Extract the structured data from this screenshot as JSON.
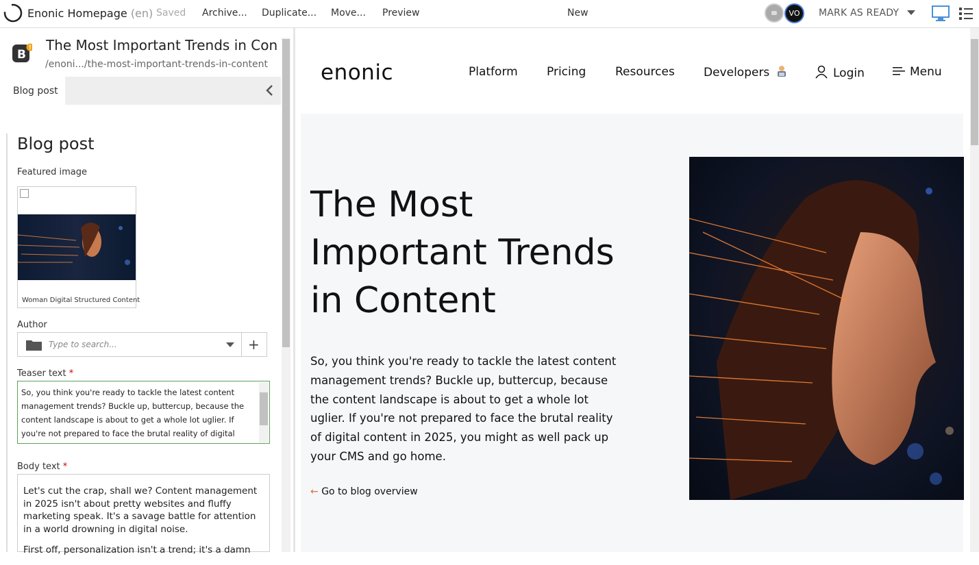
{
  "toolbar": {
    "app_title": "Enonic Homepage",
    "language": "(en)",
    "saved": "Saved",
    "archive": "Archive...",
    "duplicate": "Duplicate...",
    "move": "Move...",
    "preview": "Preview",
    "status": "New",
    "user_initials": "VO",
    "mark_as_ready": "MARK AS READY",
    "accent_color": "#4a90d9"
  },
  "content_header": {
    "title": "The Most Important Trends in Con...",
    "path": "/enoni.../the-most-important-trends-in-content",
    "icon": "blog-post-icon"
  },
  "tabs": {
    "active": "Blog post"
  },
  "form": {
    "heading": "Blog post",
    "featured_image_label": "Featured image",
    "featured_image_caption": "Woman Digital Structured Content",
    "author_label": "Author",
    "author_placeholder": "Type to search...",
    "author_add": "+",
    "teaser_label": "Teaser text",
    "required_mark": "*",
    "teaser_value": "So, you think you're ready to tackle the latest content management trends? Buckle up, buttercup, because the content landscape is about to get a whole lot uglier. If you're not prepared to face the brutal reality of digital content in",
    "body_label": "Body text",
    "body_p1": "Let's cut the crap, shall we? Content management in 2025 isn't about pretty websites and fluffy marketing speak. It's a savage battle for attention in a world drowning in digital noise.",
    "body_p2": "First off, personalization isn't a trend; it's a damn"
  },
  "site": {
    "logo": "enonic",
    "nav": {
      "platform": "Platform",
      "pricing": "Pricing",
      "resources": "Resources",
      "developers": "Developers",
      "login": "Login",
      "menu": "Menu"
    },
    "hero": {
      "title": "The Most Important Trends in Content",
      "lead": "So, you think you're ready to tackle the latest content management trends? Buckle up, buttercup, because the content landscape is about to get a whole lot uglier. If you're not prepared to face the brutal reality of digital content in 2025, you might as well pack up your CMS and go home.",
      "back_link": "Go to blog overview"
    }
  }
}
